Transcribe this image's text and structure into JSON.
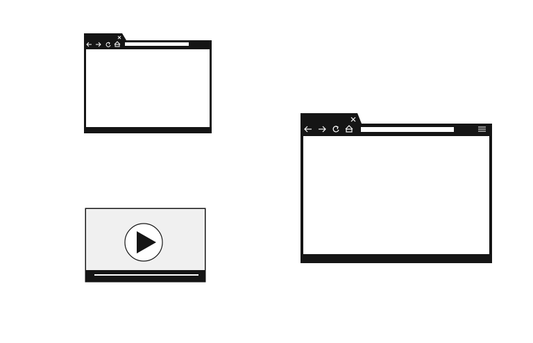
{
  "illustrations": [
    {
      "id": "small-browser",
      "icons": [
        "back-arrow-icon",
        "forward-arrow-icon",
        "refresh-icon",
        "home-icon",
        "close-icon"
      ]
    },
    {
      "id": "large-browser",
      "icons": [
        "back-arrow-icon",
        "forward-arrow-icon",
        "refresh-icon",
        "home-icon",
        "close-icon",
        "hamburger-menu-icon"
      ]
    },
    {
      "id": "video-player",
      "icons": [
        "play-icon"
      ]
    }
  ],
  "colors": {
    "frame": "#151515",
    "address_bar": "#ffffff",
    "viewport": "#ffffff",
    "video_area": "#f0f0f0",
    "progress_track": "#ffffff"
  },
  "background": "#ffffff"
}
